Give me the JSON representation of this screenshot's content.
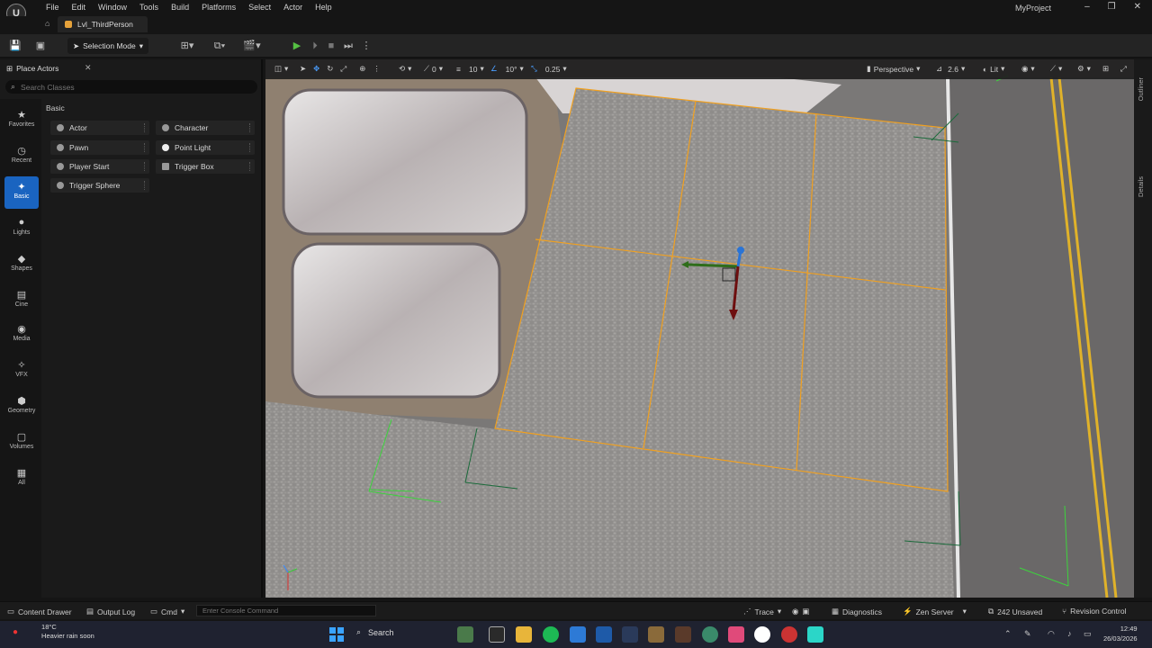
{
  "menu": {
    "items": [
      "File",
      "Edit",
      "Window",
      "Tools",
      "Build",
      "Platforms",
      "Select",
      "Actor",
      "Help"
    ],
    "project_name": "MyProject",
    "logo_letter": "U"
  },
  "tabs": {
    "level": "Lvl_ThirdPerson"
  },
  "toolbar": {
    "selection_mode": "Selection Mode"
  },
  "place_actors": {
    "title": "Place Actors",
    "search_placeholder": "Search Classes",
    "section": "Basic",
    "categories": [
      "Favorites",
      "Recent",
      "Basic",
      "Lights",
      "Shapes",
      "Cine",
      "Media",
      "VFX",
      "Geometry",
      "Volumes",
      "All"
    ],
    "active_category": "Basic",
    "actors_left": [
      "Actor",
      "Pawn",
      "Player Start",
      "Trigger Sphere"
    ],
    "actors_right": [
      "Character",
      "Point Light",
      "Trigger Box"
    ]
  },
  "viewport": {
    "translate_snap": "10",
    "rotate_snap": "10°",
    "scale_snap": "0.25",
    "grid_count": "0",
    "view_mode": "Perspective",
    "camera_speed": "2.6",
    "lit_mode": "Lit"
  },
  "right_tabs": {
    "outliner": "Outliner",
    "details": "Details"
  },
  "statusbar": {
    "content_drawer": "Content Drawer",
    "output_log": "Output Log",
    "cmd": "Cmd",
    "console_placeholder": "Enter Console Command",
    "trace": "Trace",
    "diagnostics": "Diagnostics",
    "zen_server": "Zen Server",
    "unsaved": "242 Unsaved",
    "revision_control": "Revision Control"
  },
  "taskbar": {
    "temperature": "18°C",
    "weather": "Heavier rain soon",
    "search": "Search",
    "time": "12:49",
    "date": "26/03/2026"
  }
}
